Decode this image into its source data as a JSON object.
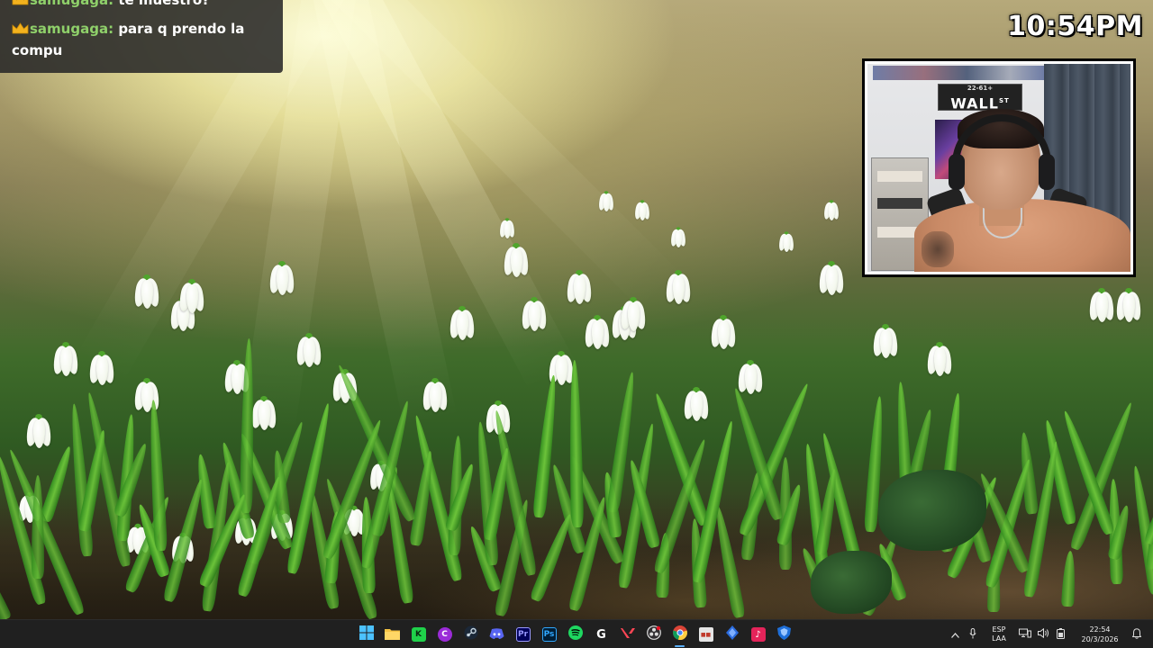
{
  "chat": {
    "messages": [
      {
        "user": "samugaga:",
        "text": "te muestro?"
      },
      {
        "user": "samugaga:",
        "text": "para q prendo la compu"
      }
    ]
  },
  "stream_clock": "10:54PM",
  "webcam": {
    "sign_small": "22-61+",
    "sign_big": "WALL",
    "sign_suffix": "ST"
  },
  "taskbar": {
    "apps": [
      {
        "name": "start",
        "icon": "windows-logo"
      },
      {
        "name": "file-explorer",
        "icon": "folder-icon"
      },
      {
        "name": "app-green",
        "icon": "k-icon"
      },
      {
        "name": "app-c",
        "icon": "c-icon"
      },
      {
        "name": "steam",
        "icon": "steam-icon"
      },
      {
        "name": "discord",
        "icon": "discord-icon"
      },
      {
        "name": "premiere",
        "icon": "pr-icon",
        "label": "Pr"
      },
      {
        "name": "photoshop",
        "icon": "ps-icon",
        "label": "Ps"
      },
      {
        "name": "spotify",
        "icon": "spotify-icon"
      },
      {
        "name": "epic-games",
        "icon": "g-icon"
      },
      {
        "name": "valorant",
        "icon": "valorant-icon"
      },
      {
        "name": "obs",
        "icon": "obs-icon"
      },
      {
        "name": "chrome",
        "icon": "chrome-icon"
      },
      {
        "name": "streamlabs",
        "icon": "streamer-icon"
      },
      {
        "name": "app-diamond",
        "icon": "diamond-icon"
      },
      {
        "name": "tiktok",
        "icon": "tiktok-icon"
      },
      {
        "name": "app-shield",
        "icon": "shield-icon"
      }
    ],
    "tray": {
      "language_line1": "ESP",
      "language_line2": "LAA",
      "time": "22:54",
      "date": "20/3/2026"
    }
  },
  "colors": {
    "chat_username": "#8fd06a",
    "taskbar_bg": "#202020",
    "active_indicator": "#5bb0ff"
  }
}
